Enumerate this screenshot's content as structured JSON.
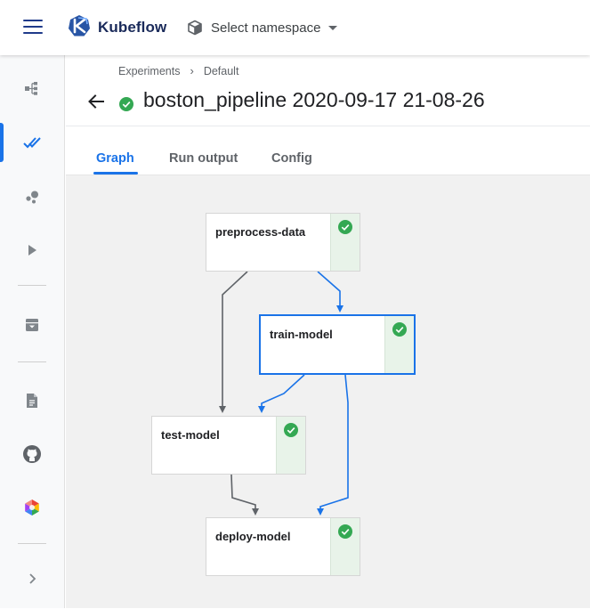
{
  "app": {
    "brand": "Kubeflow",
    "namespace_label": "Select namespace"
  },
  "breadcrumb": {
    "items": [
      "Experiments",
      "Default"
    ],
    "separator": "›"
  },
  "run": {
    "title": "boston_pipeline 2020-09-17 21-08-26",
    "status": "succeeded"
  },
  "tabs": [
    {
      "label": "Graph",
      "active": true
    },
    {
      "label": "Run output",
      "active": false
    },
    {
      "label": "Config",
      "active": false
    }
  ],
  "sidebar": {
    "items": [
      {
        "icon": "pipelines-icon",
        "active": false
      },
      {
        "icon": "experiments-icon",
        "active": true
      },
      {
        "icon": "artifacts-icon",
        "active": false
      },
      {
        "icon": "executions-icon",
        "active": false
      },
      {
        "icon": "archive-icon",
        "active": false
      },
      {
        "icon": "documentation-icon",
        "active": false
      },
      {
        "icon": "github-icon",
        "active": false
      },
      {
        "icon": "ai-platform-icon",
        "active": false
      },
      {
        "icon": "chevron-right-icon",
        "active": false
      }
    ]
  },
  "graph": {
    "nodes": [
      {
        "id": "preprocess-data",
        "label": "preprocess-data",
        "status": "succeeded"
      },
      {
        "id": "train-model",
        "label": "train-model",
        "status": "succeeded",
        "selected": true
      },
      {
        "id": "test-model",
        "label": "test-model",
        "status": "succeeded"
      },
      {
        "id": "deploy-model",
        "label": "deploy-model",
        "status": "succeeded"
      }
    ],
    "edges": [
      {
        "from": "preprocess-data",
        "to": "train-model"
      },
      {
        "from": "preprocess-data",
        "to": "test-model"
      },
      {
        "from": "train-model",
        "to": "test-model"
      },
      {
        "from": "train-model",
        "to": "deploy-model"
      },
      {
        "from": "test-model",
        "to": "deploy-model"
      }
    ]
  },
  "colors": {
    "accent": "#1a73e8",
    "success": "#34a853",
    "edge_default": "#5f6368",
    "edge_selected": "#1a73e8"
  }
}
